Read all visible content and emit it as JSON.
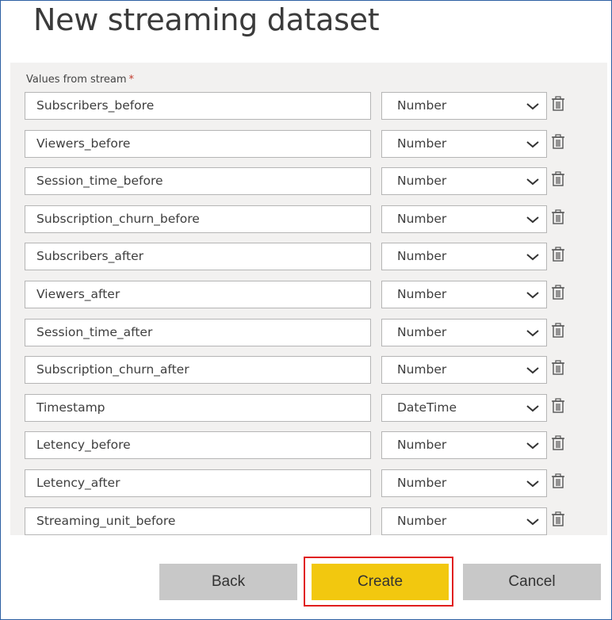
{
  "dialog": {
    "title": "New streaming dataset",
    "values_label": "Values from stream",
    "required_marker": "*"
  },
  "fields": [
    {
      "name": "Subscribers_before",
      "type": "Number"
    },
    {
      "name": "Viewers_before",
      "type": "Number"
    },
    {
      "name": "Session_time_before",
      "type": "Number"
    },
    {
      "name": "Subscription_churn_before",
      "type": "Number"
    },
    {
      "name": "Subscribers_after",
      "type": "Number"
    },
    {
      "name": "Viewers_after",
      "type": "Number"
    },
    {
      "name": "Session_time_after",
      "type": "Number"
    },
    {
      "name": "Subscription_churn_after",
      "type": "Number"
    },
    {
      "name": "Timestamp",
      "type": "DateTime"
    },
    {
      "name": "Letency_before",
      "type": "Number"
    },
    {
      "name": "Letency_after",
      "type": "Number"
    },
    {
      "name": "Streaming_unit_before",
      "type": "Number"
    }
  ],
  "icons": {
    "dropdown": "chevron-down-icon",
    "delete": "trash-icon"
  },
  "footer": {
    "back_label": "Back",
    "create_label": "Create",
    "cancel_label": "Cancel"
  },
  "colors": {
    "primary_button": "#f2c80f",
    "secondary_button": "#c8c8c8",
    "highlight_border": "#e01e1e",
    "frame_border": "#2e5fa3",
    "panel_background": "#f2f1f0",
    "required_star": "#c0392b"
  }
}
